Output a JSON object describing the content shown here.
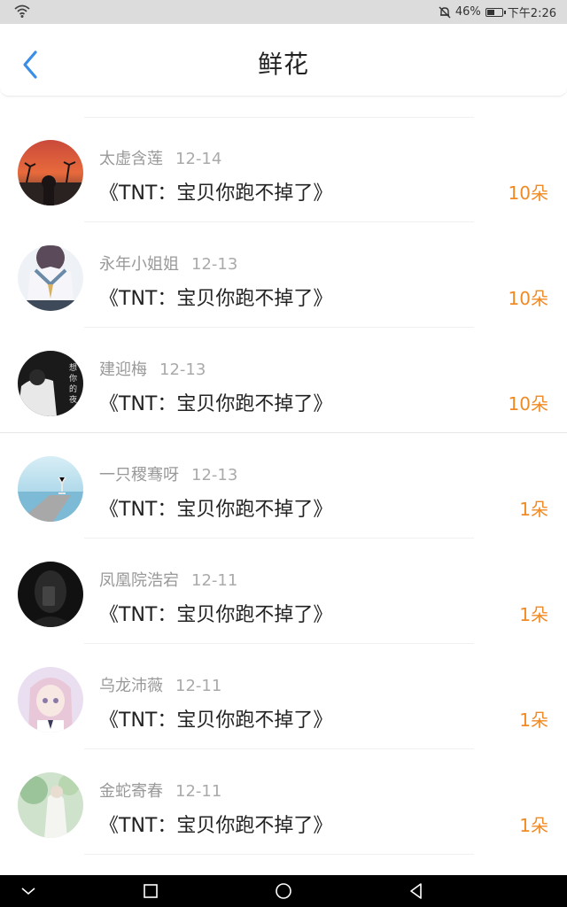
{
  "status_bar": {
    "battery": "46%",
    "time": "下午2:26",
    "battery_level": 0.46
  },
  "header": {
    "title": "鲜花"
  },
  "gifts": [
    {
      "user": "太虚含莲",
      "date": "12-14",
      "book": "《TNT：宝贝你跑不掉了》",
      "amount": "10朵",
      "avatar": "sunset-avatar"
    },
    {
      "user": "永年小姐姐",
      "date": "12-13",
      "book": "《TNT：宝贝你跑不掉了》",
      "amount": "10朵",
      "avatar": "anime-sailor-avatar"
    },
    {
      "user": "建迎梅",
      "date": "12-13",
      "book": "《TNT：宝贝你跑不掉了》",
      "amount": "10朵",
      "avatar": "dark-calligraphy-avatar"
    },
    {
      "user": "一只稷骞呀",
      "date": "12-13",
      "book": "《TNT：宝贝你跑不掉了》",
      "amount": "1朵",
      "avatar": "sea-yoga-avatar"
    },
    {
      "user": "凤凰院浩宕",
      "date": "12-11",
      "book": "《TNT：宝贝你跑不掉了》",
      "amount": "1朵",
      "avatar": "dark-selfie-avatar"
    },
    {
      "user": "乌龙沛薇",
      "date": "12-11",
      "book": "《TNT：宝贝你跑不掉了》",
      "amount": "1朵",
      "avatar": "anime-girl-avatar"
    },
    {
      "user": "金蛇寄春",
      "date": "12-11",
      "book": "《TNT：宝贝你跑不掉了》",
      "amount": "1朵",
      "avatar": "green-scene-avatar"
    }
  ],
  "colors": {
    "accent": "#f08a24",
    "back": "#3a8ee6",
    "username": "#999999",
    "text": "#222222"
  }
}
